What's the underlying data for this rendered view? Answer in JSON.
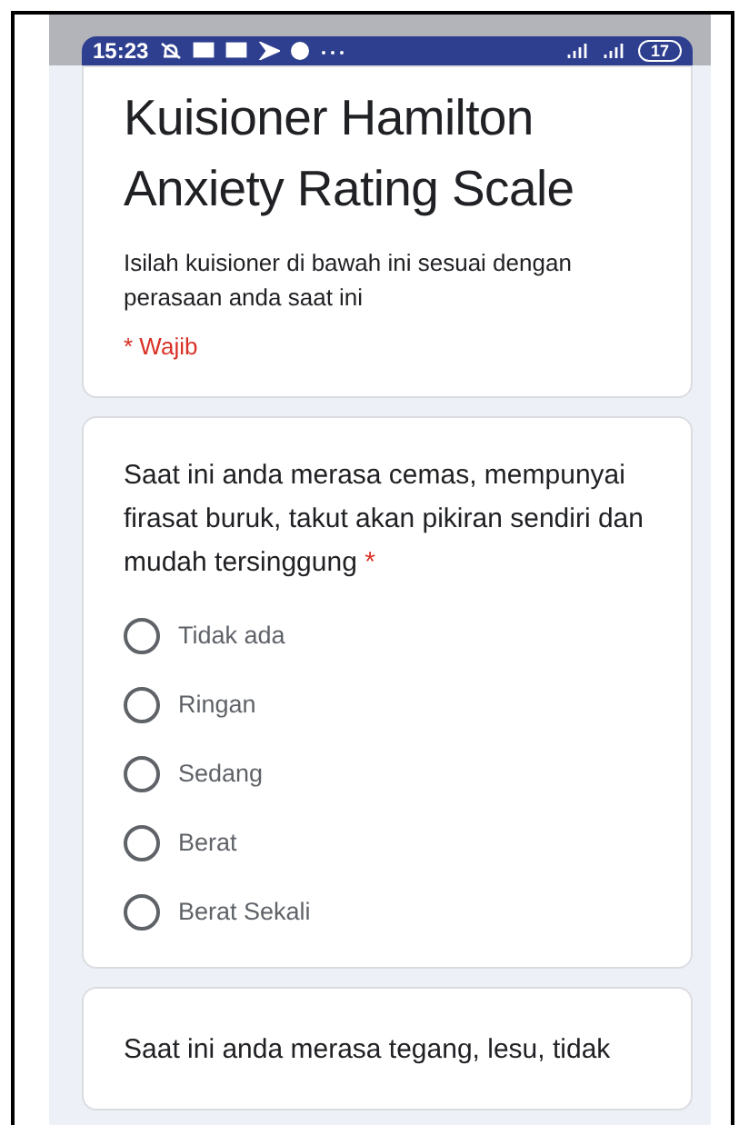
{
  "status_bar": {
    "time": "15:23",
    "battery": "17"
  },
  "header": {
    "title": "Kuisioner Hamilton Anxiety Rating Scale",
    "description": "Isilah kuisioner di bawah ini sesuai dengan perasaan anda saat ini",
    "required_note": "* Wajib"
  },
  "questions": [
    {
      "text": "Saat ini anda merasa cemas, mempunyai firasat buruk, takut akan pikiran sendiri dan mudah tersinggung",
      "required_mark": "*",
      "options": [
        {
          "label": "Tidak ada",
          "selected": false
        },
        {
          "label": "Ringan",
          "selected": false
        },
        {
          "label": "Sedang",
          "selected": false
        },
        {
          "label": "Berat",
          "selected": false
        },
        {
          "label": "Berat Sekali",
          "selected": false
        }
      ]
    },
    {
      "text": "Saat ini anda merasa tegang, lesu, tidak"
    }
  ]
}
